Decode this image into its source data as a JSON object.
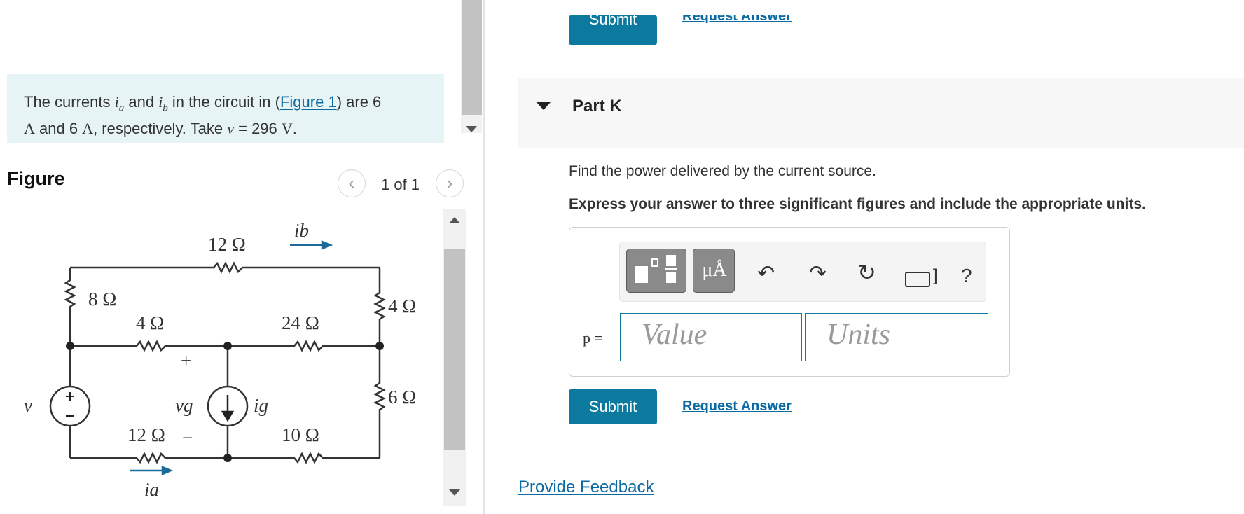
{
  "problem": {
    "text_prefix": "The currents ",
    "var_ia": "ia",
    "text_and": " and ",
    "var_ib": "ib",
    "text_mid": " in the circuit in (",
    "figure_link": "Figure 1",
    "text_after_link": ") are 6",
    "unit_a1": "A",
    "text_and6": " and 6 ",
    "unit_a2": "A",
    "text_resp": ", respectively. Take ",
    "var_v": "v",
    "text_eq": " = 296 ",
    "unit_v": "V",
    "text_end": "."
  },
  "figure": {
    "title": "Figure",
    "counter": "1 of 1",
    "prev_icon": "chevron-left-icon",
    "next_icon": "chevron-right-icon",
    "circuit": {
      "r_top": "12 Ω",
      "r_left_top": "8 Ω",
      "r_mid_left": "4 Ω",
      "r_mid_right": "24 Ω",
      "r_right_top": "4 Ω",
      "r_right_bottom": "6 Ω",
      "r_bottom_left": "12 Ω",
      "r_bottom_right": "10 Ω",
      "label_ib": "ib",
      "label_ia": "ia",
      "label_ig": "ig",
      "label_vg": "vg",
      "label_v": "v",
      "plus": "+",
      "minus": "−"
    }
  },
  "top_actions": {
    "submit": "Submit",
    "request": "Request Answer"
  },
  "part": {
    "title": "Part K",
    "question": "Find the power delivered by the current source.",
    "instruction": "Express your answer to three significant figures and include the appropriate units.",
    "variable_label": "p =",
    "value_placeholder": "Value",
    "units_placeholder": "Units",
    "toolbar": {
      "units_button": "μÅ",
      "undo_icon": "undo-icon",
      "redo_icon": "redo-icon",
      "reset_icon": "reset-icon",
      "keyboard_icon": "keyboard-icon",
      "help": "?"
    },
    "submit": "Submit",
    "request": "Request Answer"
  },
  "feedback": "Provide Feedback"
}
